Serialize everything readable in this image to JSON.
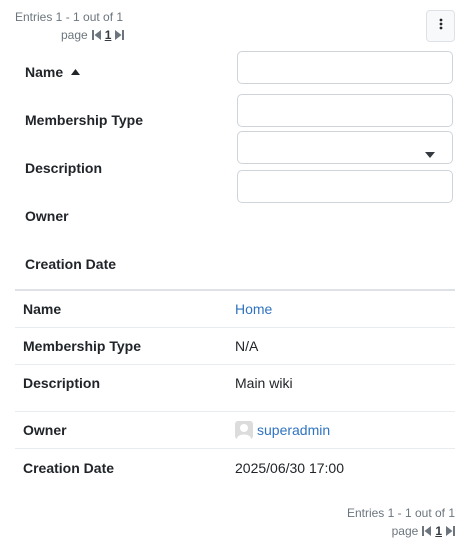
{
  "pager": {
    "entries_text": "Entries 1 - 1 out of 1",
    "page_label": "page",
    "current_page": "1"
  },
  "filters": {
    "labels": [
      "Name",
      "Membership Type",
      "Description",
      "Owner",
      "Creation Date"
    ],
    "name_value": "",
    "membership_value": "",
    "description_value": ""
  },
  "record": {
    "rows": [
      {
        "key": "Name",
        "value": "Home"
      },
      {
        "key": "Membership Type",
        "value": "N/A"
      },
      {
        "key": "Description",
        "value": "Main wiki"
      },
      {
        "key": "Owner",
        "value": "superadmin"
      },
      {
        "key": "Creation Date",
        "value": "2025/06/30 17:00"
      }
    ]
  },
  "icons": {
    "menu": "vertical-ellipsis-icon",
    "first": "first-page-icon",
    "last": "last-page-icon",
    "sort": "sort-ascending-icon",
    "caret": "caret-down-icon",
    "avatar": "user-avatar-icon"
  },
  "colors": {
    "link": "#2f73c0",
    "muted": "#6c757d",
    "border": "#ced4da"
  }
}
